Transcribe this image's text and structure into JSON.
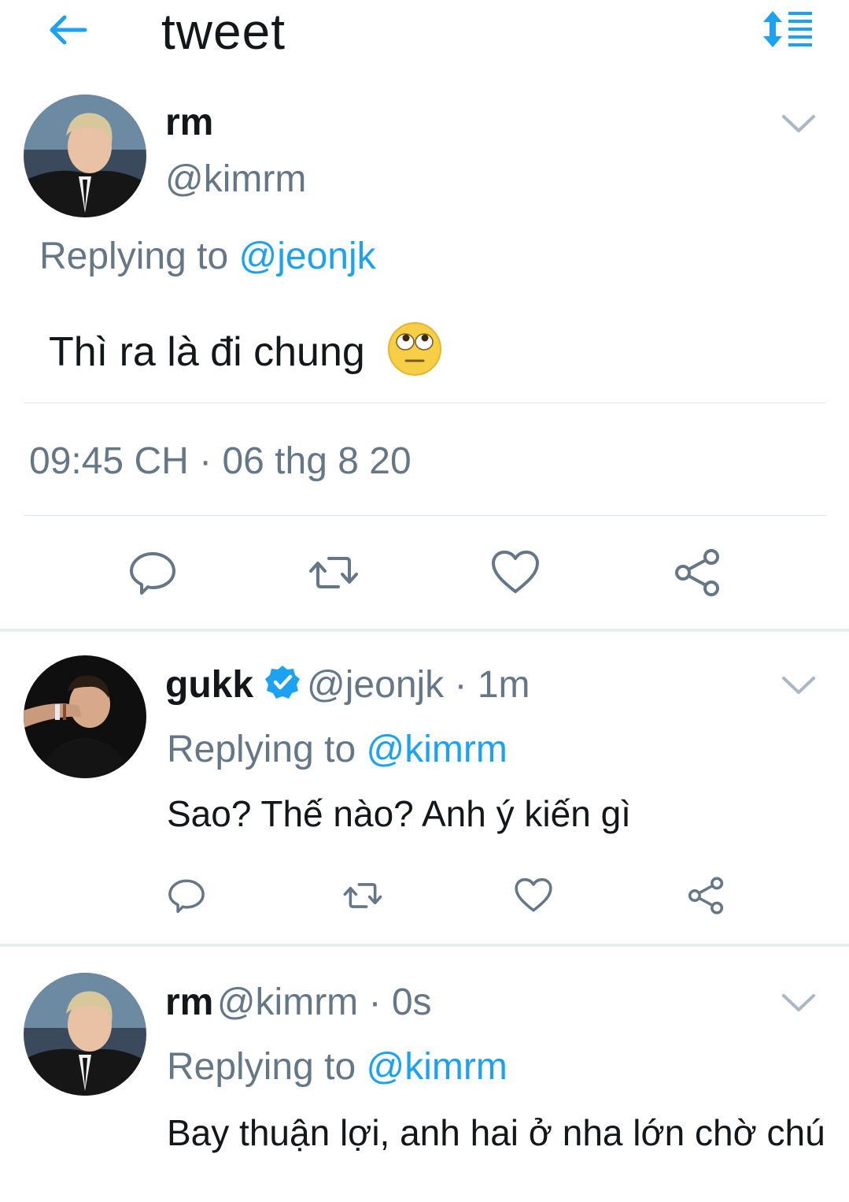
{
  "header": {
    "title": "tweet",
    "back_icon": "back-arrow-icon",
    "sort_icon": "sort-list-icon",
    "accent": "#1da1f2"
  },
  "main_tweet": {
    "display_name": "rm",
    "handle": "@kimrm",
    "replying_prefix": "Replying to",
    "replying_to": "@jeonjk",
    "text": "Thì ra là đi chung",
    "emoji": "🙄",
    "timestamp": "09:45 CH · 06 thg 8 20",
    "actions": [
      "reply-icon",
      "retweet-icon",
      "like-icon",
      "share-icon"
    ]
  },
  "replies": [
    {
      "display_name": "gukk",
      "verified": true,
      "handle_time": "@jeonjk · 1m",
      "replying_prefix": "Replying to",
      "replying_to": "@kimrm",
      "text": "Sao? Thế nào? Anh ý kiến gì"
    },
    {
      "display_name": "rm",
      "handle_time": "@kimrm · 0s",
      "replying_prefix": "Replying to",
      "replying_to": "@kimrm",
      "text": "Bay thuận lợi, anh hai ở nha lớn chờ chú"
    }
  ],
  "colors": {
    "link": "#1da1f2",
    "muted": "#657786",
    "text": "#14171a",
    "divider": "#e1e8ed"
  }
}
